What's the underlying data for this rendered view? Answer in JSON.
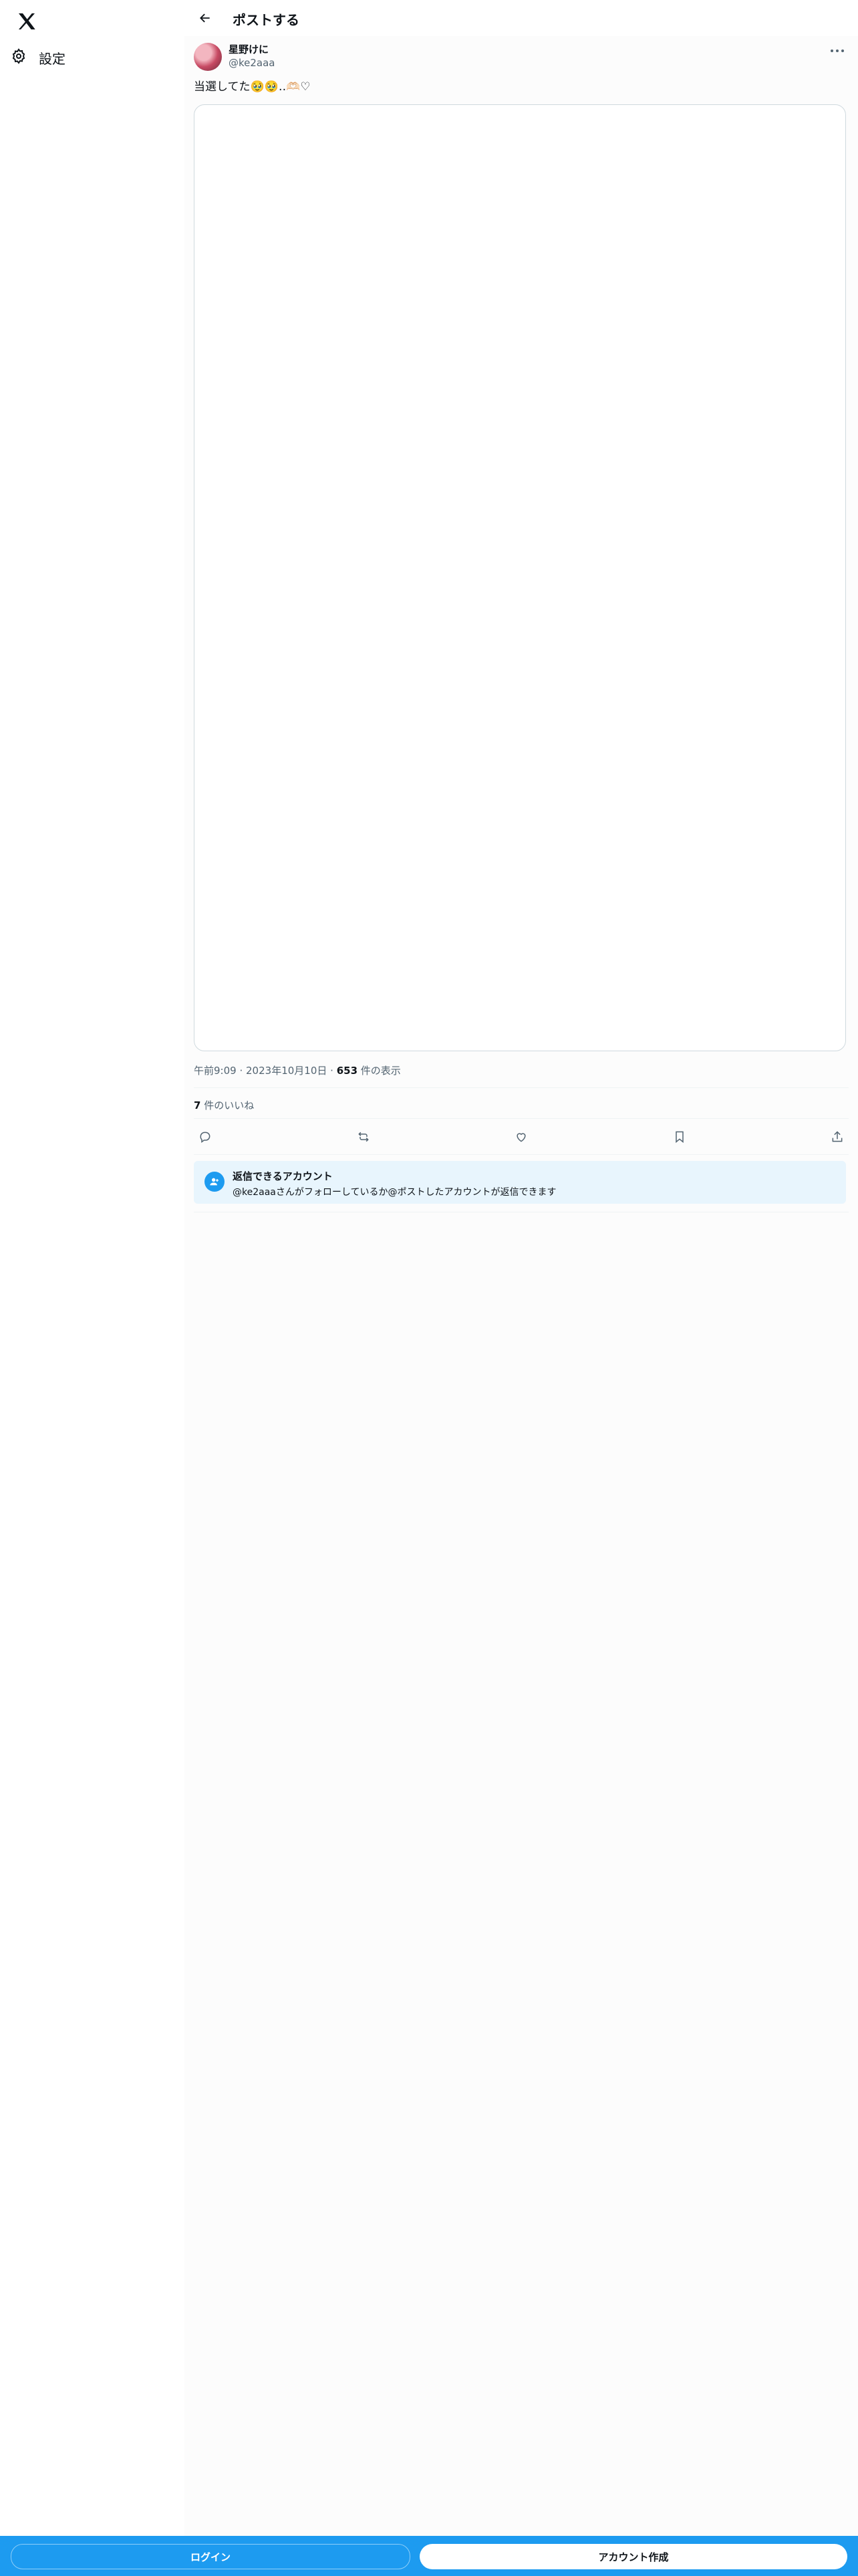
{
  "sidebar": {
    "logo_icon": "x-logo-icon",
    "settings_icon": "gear-icon",
    "settings_label": "設定"
  },
  "header": {
    "back_icon": "arrow-left-icon",
    "title": "ポストする"
  },
  "post": {
    "author_name": "星野けに",
    "author_handle": "@ke2aaa",
    "more_icon": "more-horizontal-icon",
    "text": "当選してた🥹🥹‥🫶🏻♡",
    "time": "午前9:09",
    "date": "2023年10月10日",
    "views_count": "653",
    "views_label": " 件の表示",
    "likes_count": "7",
    "likes_label": " 件のいいね",
    "actions": [
      "reply-icon",
      "repost-icon",
      "like-icon",
      "bookmark-icon",
      "share-icon"
    ]
  },
  "reply_notice": {
    "icon": "person-add-icon",
    "title": "返信できるアカウント",
    "description": "@ke2aaaさんがフォローしているか@ポストしたアカウントが返信できます"
  },
  "bottom_bar": {
    "login_label": "ログイン",
    "signup_label": "アカウント作成"
  },
  "colors": {
    "accent": "#1d9bf0",
    "reply_bg": "#e8f5fd"
  }
}
